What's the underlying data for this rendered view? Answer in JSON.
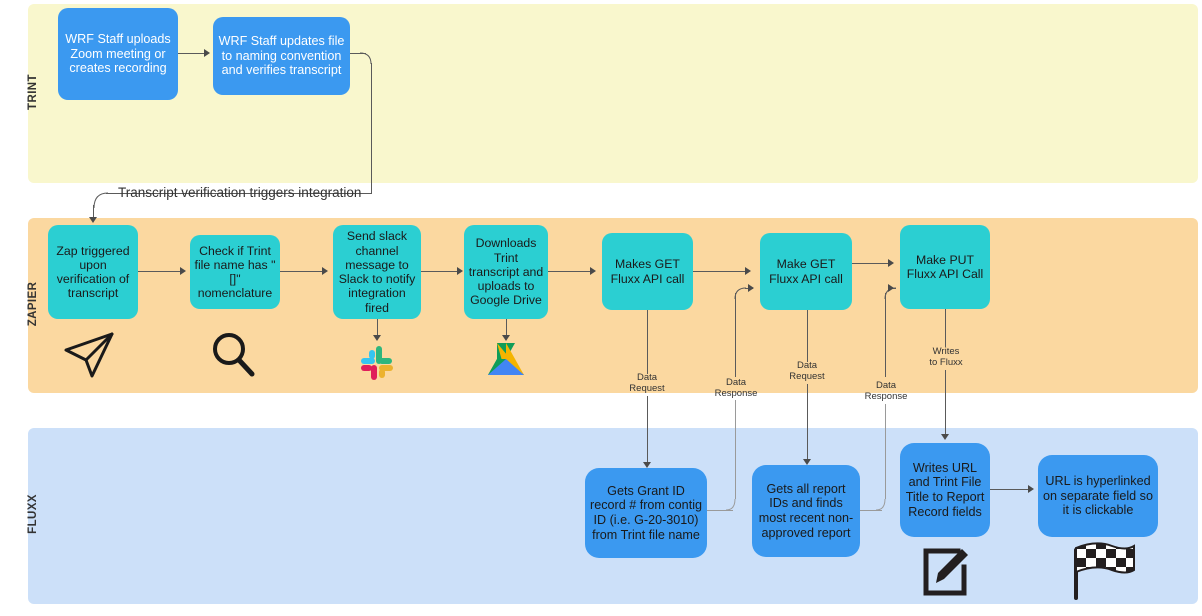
{
  "diagram": {
    "title": "Trint / Zapier / Fluxx transcript integration swimlane flowchart",
    "colors": {
      "lane_trint": "#f9f7cd",
      "lane_zapier": "#fbd8a0",
      "lane_fluxx": "#cce0f9",
      "node_blue": "#3b99f0",
      "node_teal": "#2bcfd2",
      "edge": "#5a5a5a"
    }
  },
  "lanes": [
    {
      "id": "trint",
      "label": "TRINT"
    },
    {
      "id": "zapier",
      "label": "ZAPIER"
    },
    {
      "id": "fluxx",
      "label": "FLUXX"
    }
  ],
  "trint": {
    "nodes": [
      {
        "id": "t1",
        "text": "WRF Staff uploads Zoom meeting or creates recording"
      },
      {
        "id": "t2",
        "text": "WRF Staff updates file to naming convention and verifies transcript"
      }
    ]
  },
  "trigger": {
    "label": "Transcript verification triggers integration"
  },
  "zapier": {
    "nodes": [
      {
        "id": "z1",
        "text": "Zap triggered upon verification of transcript"
      },
      {
        "id": "z2",
        "text": "Check if Trint file name has \"[]\" nomenclature"
      },
      {
        "id": "z3",
        "text": "Send slack channel message to Slack to notify integration fired"
      },
      {
        "id": "z4",
        "text": "Downloads Trint transcript and uploads to Google Drive"
      },
      {
        "id": "z5",
        "text": "Makes GET Fluxx API call"
      },
      {
        "id": "z6",
        "text": "Make GET Fluxx API call"
      },
      {
        "id": "z7",
        "text": "Make PUT Fluxx API Call"
      }
    ],
    "icons": [
      {
        "id": "send-icon",
        "name": "send-paper-plane-icon"
      },
      {
        "id": "search-icon",
        "name": "magnifier-search-icon"
      },
      {
        "id": "slack-icon",
        "name": "slack-logo-icon"
      },
      {
        "id": "google-drive-icon",
        "name": "google-drive-logo-icon"
      }
    ]
  },
  "fluxx": {
    "nodes": [
      {
        "id": "f1",
        "text": "Gets Grant ID record # from contig ID (i.e. G-20-3010) from Trint file name"
      },
      {
        "id": "f2",
        "text": "Gets all report IDs and finds most recent non-approved report"
      },
      {
        "id": "f3",
        "text": "Writes URL and Trint File Title to Report Record fields"
      },
      {
        "id": "f4",
        "text": "URL is hyperlinked on separate field so it is clickable"
      }
    ],
    "icons": [
      {
        "id": "edit-icon",
        "name": "edit-pencil-square-icon"
      },
      {
        "id": "flag-icon",
        "name": "checkered-finish-flag-icon"
      }
    ]
  },
  "edge_labels": {
    "data_request_1": "Data\nRequest",
    "data_response_1": "Data\nResponse",
    "data_request_2": "Data\nRequest",
    "data_response_2": "Data\nResponse",
    "writes_to_fluxx": "Writes\nto Fluxx"
  }
}
